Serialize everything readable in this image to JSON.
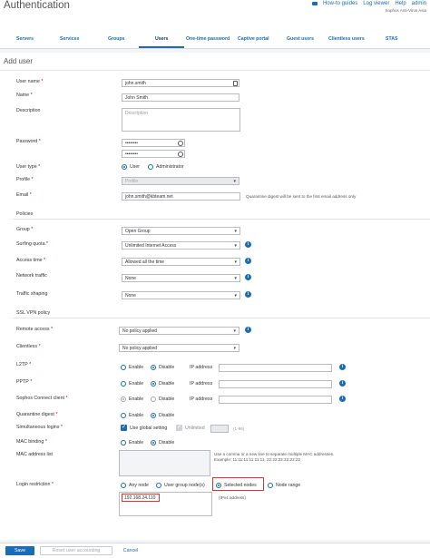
{
  "header": {
    "title": "Authentication",
    "links": [
      "How-to guides",
      "Log viewer",
      "Help",
      "admin"
    ],
    "subtitle": "Sophos Anti-Virus Asia"
  },
  "tabs": [
    {
      "label": "Servers"
    },
    {
      "label": "Services"
    },
    {
      "label": "Groups"
    },
    {
      "label": "Users",
      "active": true
    },
    {
      "label": "One-time password"
    },
    {
      "label": "Captive portal"
    },
    {
      "label": "Guest users"
    },
    {
      "label": "Clientless users"
    },
    {
      "label": "STAS"
    }
  ],
  "form": {
    "section_title": "Add user",
    "username_label": "User name",
    "username_value": "john.smith",
    "name_label": "Name",
    "name_value": "John Smith",
    "description_label": "Description",
    "description_placeholder": "Description",
    "password_label": "Password",
    "password_value": "••••••••",
    "password_confirm_value": "••••••••",
    "usertype_label": "User type",
    "usertype_options": [
      "User",
      "Administrator"
    ],
    "profile_label": "Profile",
    "profile_value": "Profile",
    "email_label": "Email",
    "email_value": "john.smith@kbteam.net",
    "email_hint": "Quarantine digest will be sent to the first email address only",
    "policies_title": "Policies",
    "group_label": "Group",
    "group_value": "Open Group",
    "surfing_label": "Surfing quota",
    "surfing_value": "Unlimited Internet Access",
    "access_label": "Access time",
    "access_value": "Allowed all the time",
    "network_label": "Network traffic",
    "network_value": "None",
    "traffic_label": "Traffic shaping",
    "traffic_value": "None",
    "sslvpn_title": "SSL VPN policy",
    "remote_label": "Remote access",
    "remote_value": "No policy applied",
    "clientless_label": "Clientless",
    "clientless_value": "No policy applied",
    "l2tp_label": "L2TP",
    "pptp_label": "PPTP",
    "sophos_connect_label": "Sophos Connect client",
    "enable_label": "Enable",
    "disable_label": "Disable",
    "ip_address_label": "IP address",
    "quarantine_label": "Quarantine digest",
    "simultaneous_label": "Simultaneous logins",
    "use_global_label": "Use global setting",
    "unlimited_label": "Unlimited",
    "range_hint": "(1-99)",
    "mac_binding_label": "MAC binding",
    "mac_list_label": "MAC address list",
    "mac_hint_1": "Use a comma or a new line to separate multiple MAC addresses.",
    "mac_hint_2": "Example: 11:11:11:11:11:11, 22:22:22:22:22:22",
    "login_restriction_label": "Login restriction",
    "login_options": [
      "Any node",
      "User group node(s)",
      "Selected nodes",
      "Node range"
    ],
    "ip_list_value": "192.168.24.110",
    "ipv4_hint": "(IPv4 address)"
  },
  "footer": {
    "save": "Save",
    "reset": "Reset user accounting",
    "cancel": "Cancel"
  },
  "colors": {
    "accent": "#1a6db5",
    "highlight": "#d33333"
  }
}
